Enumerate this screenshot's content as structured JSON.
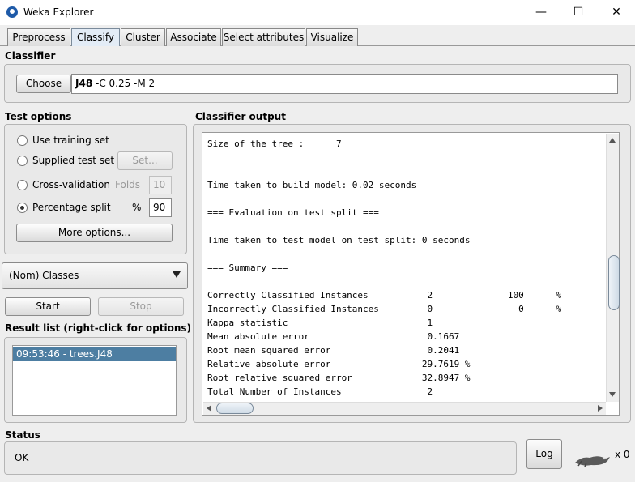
{
  "window": {
    "title": "Weka Explorer",
    "minimize": "—",
    "maximize": "☐",
    "close": "✕"
  },
  "tabs": [
    "Preprocess",
    "Classify",
    "Cluster",
    "Associate",
    "Select attributes",
    "Visualize"
  ],
  "active_tab": "Classify",
  "classifier": {
    "section_label": "Classifier",
    "choose_label": "Choose",
    "name": "J48",
    "options": " -C 0.25 -M 2"
  },
  "test_options": {
    "section_label": "Test options",
    "use_training_set": "Use training set",
    "supplied_test_set": "Supplied test set",
    "set_button": "Set...",
    "cross_validation": "Cross-validation",
    "folds_label": "Folds",
    "folds_value": "10",
    "percentage_split": "Percentage split",
    "percent_sign": "%",
    "percent_value": "90",
    "selected": "percentage_split",
    "more_options": "More options..."
  },
  "class_selector": {
    "value": "(Nom) Classes"
  },
  "start_label": "Start",
  "stop_label": "Stop",
  "result_list": {
    "section_label": "Result list (right-click for options)",
    "items": [
      "09:53:46 - trees.J48"
    ]
  },
  "output": {
    "section_label": "Classifier output",
    "lines": [
      "Size of the tree :      7",
      "",
      "",
      "Time taken to build model: 0.02 seconds",
      "",
      "=== Evaluation on test split ===",
      "",
      "Time taken to test model on test split: 0 seconds",
      "",
      "=== Summary ===",
      "",
      "Correctly Classified Instances           2              100      %",
      "Incorrectly Classified Instances         0                0      %",
      "Kappa statistic                          1",
      "Mean absolute error                      0.1667",
      "Root mean squared error                  0.2041",
      "Relative absolute error                 29.7619 %",
      "Root relative squared error             32.8947 %",
      "Total Number of Instances                2"
    ]
  },
  "status": {
    "section_label": "Status",
    "text": "OK",
    "log_label": "Log",
    "count": "x 0"
  }
}
